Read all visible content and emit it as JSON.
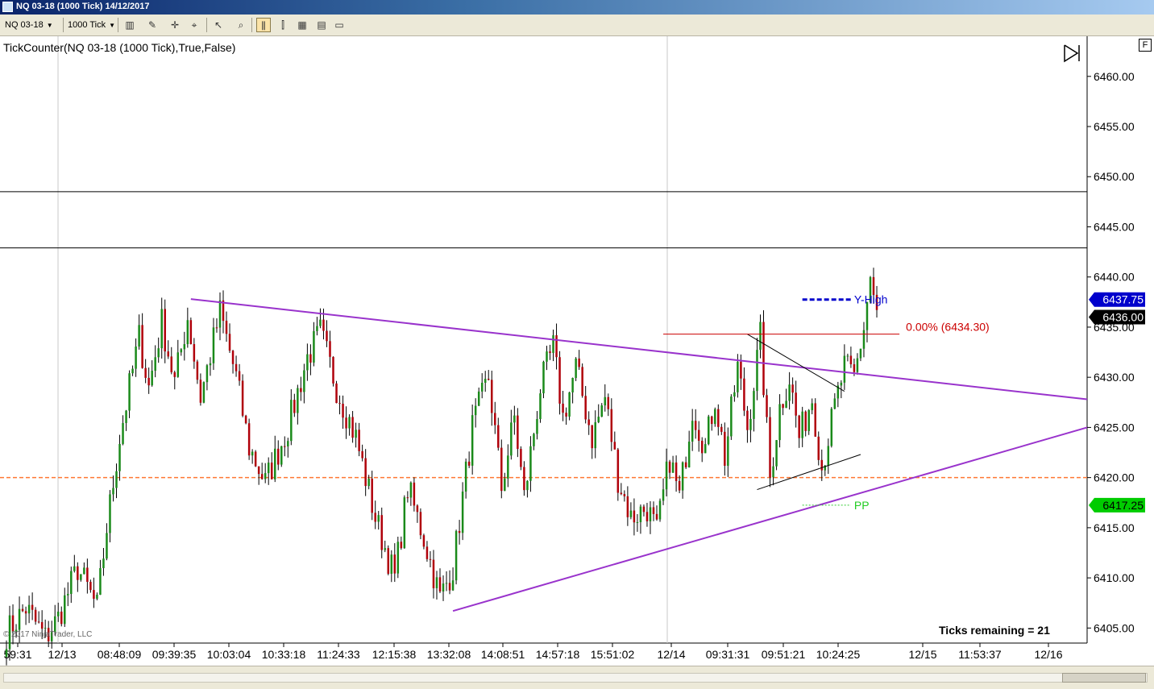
{
  "window": {
    "title": "NQ 03-18 (1000 Tick)  14/12/2017"
  },
  "toolbar": {
    "instrument": "NQ 03-18",
    "interval": "1000 Tick",
    "icons": [
      "bar-type-icon",
      "pencil-icon",
      "crosshair-icon",
      "data-box-icon",
      "pointer-icon",
      "zoom-icon",
      "chart-style-icon",
      "candle-icon",
      "screenshot-icon",
      "properties-icon",
      "panel-icon"
    ]
  },
  "indicator": {
    "label": "TickCounter(NQ 03-18 (1000 Tick),True,False)"
  },
  "ticks_remaining": "Ticks remaining = 21",
  "copyright": "© 2017 NinjaTrader, LLC",
  "panel_badge": "F",
  "y_axis": {
    "ticks": [
      "6460.00",
      "6455.00",
      "6450.00",
      "6445.00",
      "6440.00",
      "6435.00",
      "6430.00",
      "6425.00",
      "6420.00",
      "6415.00",
      "6410.00",
      "6405.00"
    ],
    "range": [
      6403.5,
      6464.0
    ]
  },
  "x_axis": {
    "labels": [
      "59:31",
      "12/13",
      "08:48:09",
      "09:39:35",
      "10:03:04",
      "10:33:18",
      "11:24:33",
      "12:15:38",
      "13:32:08",
      "14:08:51",
      "14:57:18",
      "15:51:02",
      "12/14",
      "09:31:31",
      "09:51:21",
      "10:24:25",
      "12/15",
      "11:53:37",
      "12/16"
    ]
  },
  "price_badges": {
    "y_high": {
      "value": "6437.75",
      "color": "#0000cc"
    },
    "last": {
      "value": "6436.00",
      "color": "#000000"
    },
    "pp": {
      "value": "6417.25",
      "color": "#00cc00"
    }
  },
  "annotations": {
    "y_high": {
      "text": "Y-High",
      "color": "#0000cc"
    },
    "pp": {
      "text": "PP",
      "color": "#22cc22"
    },
    "fib": {
      "text": "0.00% (6434.30)",
      "color": "#cc0000",
      "price": 6434.3
    }
  },
  "horizontal_lines": {
    "black_levels": [
      6448.5,
      6442.9
    ],
    "orange_level": 6420.0
  },
  "colors": {
    "up": "#1a8a1a",
    "down": "#b0000a",
    "wick": "#000000",
    "trend": "#9933cc",
    "orange": "#ff7733",
    "red": "#cc0000"
  },
  "chart_data": {
    "type": "candlestick",
    "symbol": "NQ 03-18",
    "interval": "1000 Tick",
    "series": [
      {
        "anchors": [
          {
            "i": 0,
            "p": 6404.5
          },
          {
            "i": 6,
            "p": 6407.0
          },
          {
            "i": 12,
            "p": 6404.0
          },
          {
            "i": 16,
            "p": 6406.0
          },
          {
            "i": 22,
            "p": 6411.0
          },
          {
            "i": 28,
            "p": 6407.0
          },
          {
            "i": 31,
            "p": 6415.0
          },
          {
            "i": 35,
            "p": 6424.0
          },
          {
            "i": 41,
            "p": 6434.0
          },
          {
            "i": 44,
            "p": 6429.0
          },
          {
            "i": 48,
            "p": 6435.5
          },
          {
            "i": 52,
            "p": 6429.5
          },
          {
            "i": 56,
            "p": 6436.0
          },
          {
            "i": 60,
            "p": 6428.0
          },
          {
            "i": 66,
            "p": 6436.5
          },
          {
            "i": 71,
            "p": 6430.0
          },
          {
            "i": 75,
            "p": 6423.0
          },
          {
            "i": 80,
            "p": 6419.5
          },
          {
            "i": 87,
            "p": 6425.0
          },
          {
            "i": 93,
            "p": 6432.0
          },
          {
            "i": 97,
            "p": 6434.5
          },
          {
            "i": 102,
            "p": 6429.0
          },
          {
            "i": 108,
            "p": 6424.0
          },
          {
            "i": 114,
            "p": 6416.0
          },
          {
            "i": 120,
            "p": 6410.0
          },
          {
            "i": 124,
            "p": 6419.0
          },
          {
            "i": 129,
            "p": 6414.0
          },
          {
            "i": 134,
            "p": 6408.0
          },
          {
            "i": 138,
            "p": 6411.0
          },
          {
            "i": 144,
            "p": 6425.0
          },
          {
            "i": 149,
            "p": 6430.0
          },
          {
            "i": 153,
            "p": 6419.0
          },
          {
            "i": 157,
            "p": 6426.0
          },
          {
            "i": 160,
            "p": 6418.0
          },
          {
            "i": 165,
            "p": 6429.0
          },
          {
            "i": 169,
            "p": 6433.0
          },
          {
            "i": 172,
            "p": 6426.0
          },
          {
            "i": 176,
            "p": 6431.0
          },
          {
            "i": 181,
            "p": 6424.0
          },
          {
            "i": 185,
            "p": 6428.0
          },
          {
            "i": 189,
            "p": 6420.0
          },
          {
            "i": 193,
            "p": 6416.0
          },
          {
            "i": 198,
            "p": 6417.0
          },
          {
            "i": 201,
            "p": 6414.5
          },
          {
            "i": 205,
            "p": 6422.0
          },
          {
            "i": 208,
            "p": 6418.0
          },
          {
            "i": 212,
            "p": 6427.0
          },
          {
            "i": 216,
            "p": 6423.0
          },
          {
            "i": 219,
            "p": 6428.0
          },
          {
            "i": 222,
            "p": 6422.0
          },
          {
            "i": 226,
            "p": 6431.0
          },
          {
            "i": 229,
            "p": 6425.0
          },
          {
            "i": 233,
            "p": 6434.0
          },
          {
            "i": 236,
            "p": 6420.0
          },
          {
            "i": 239,
            "p": 6427.0
          },
          {
            "i": 242,
            "p": 6430.0
          },
          {
            "i": 245,
            "p": 6424.0
          },
          {
            "i": 249,
            "p": 6428.0
          },
          {
            "i": 252,
            "p": 6421.0
          },
          {
            "i": 256,
            "p": 6427.0
          },
          {
            "i": 259,
            "p": 6431.0
          },
          {
            "i": 262,
            "p": 6430.0
          },
          {
            "i": 265,
            "p": 6435.0
          },
          {
            "i": 267,
            "p": 6440.0
          },
          {
            "i": 269,
            "p": 6436.0
          }
        ]
      }
    ],
    "bar_count": 270,
    "x_range": [
      0,
      334
    ],
    "overlays": {
      "trend_upper": [
        {
          "i": 57,
          "p": 6437.8
        },
        {
          "i": 334,
          "p": 6427.8
        }
      ],
      "trend_lower": [
        {
          "i": 138,
          "p": 6406.7
        },
        {
          "i": 334,
          "p": 6425.0
        }
      ],
      "triangle_upper": [
        {
          "i": 229,
          "p": 6434.3
        },
        {
          "i": 259,
          "p": 6428.6
        }
      ],
      "triangle_lower": [
        {
          "i": 232,
          "p": 6418.8
        },
        {
          "i": 264,
          "p": 6422.3
        }
      ],
      "fib_line": [
        {
          "i": 203,
          "p": 6434.3
        },
        {
          "i": 276,
          "p": 6434.3
        }
      ],
      "y_high_dash": [
        {
          "i": 246,
          "p": 6437.75
        },
        {
          "i": 261,
          "p": 6437.75
        }
      ],
      "pp_dash": [
        {
          "i": 246,
          "p": 6417.25
        },
        {
          "i": 261,
          "p": 6417.25
        }
      ]
    }
  }
}
